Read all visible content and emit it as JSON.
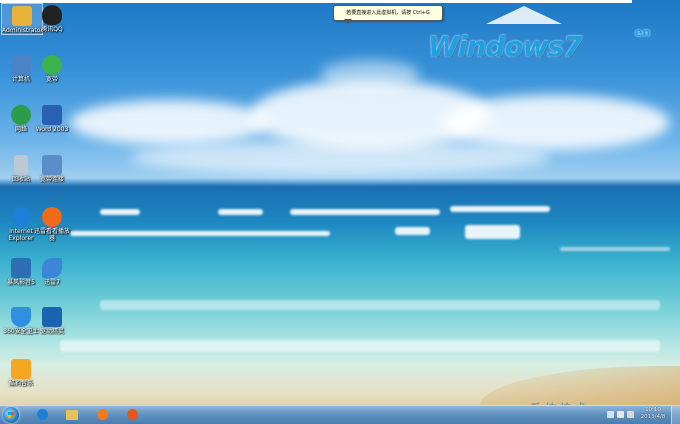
{
  "tooltip": {
    "text": "若要直接进入此虚拟机，请按 Ctrl+G"
  },
  "brand": {
    "main": "Windows7",
    "suffix": "en"
  },
  "desktop_icons": [
    {
      "label": "Administrator",
      "icon": "user-folder-icon",
      "color": "#e8b33a"
    },
    {
      "label": "腾讯QQ",
      "icon": "qq-penguin-icon",
      "color": "#222222"
    },
    {
      "label": "计算机",
      "icon": "computer-icon",
      "color": "#4a84c4"
    },
    {
      "label": "宽带",
      "icon": "network-icon",
      "color": "#3bb34a"
    },
    {
      "label": "网络",
      "icon": "globe-network-icon",
      "color": "#2d9c4a"
    },
    {
      "label": "Word 2003",
      "icon": "word-icon",
      "color": "#2b5fb2"
    },
    {
      "label": "回收站",
      "icon": "recycle-bin-icon",
      "color": "#bcc8d4"
    },
    {
      "label": "宽带连接",
      "icon": "broadband-connection-icon",
      "color": "#5b8dc9"
    },
    {
      "label": "Internet Explorer",
      "icon": "internet-explorer-icon",
      "color": "#1e7fd6"
    },
    {
      "label": "迅雷看看播放器",
      "icon": "xunlei-player-icon",
      "color": "#f06a1a"
    },
    {
      "label": "暴风影音5",
      "icon": "baofeng-player-icon",
      "color": "#2d6fb2"
    },
    {
      "label": "迅雷7",
      "icon": "xunlei-bird-icon",
      "color": "#3b86d6"
    },
    {
      "label": "360安全卫士",
      "icon": "shield-icon",
      "color": "#2f8fe0"
    },
    {
      "label": "驱动精灵",
      "icon": "driver-wizard-icon",
      "color": "#1a63b0"
    },
    {
      "label": "酷狗音乐",
      "icon": "kugou-icon",
      "color": "#f5a623"
    }
  ],
  "taskbar": {
    "pinned": [
      {
        "name": "internet-explorer",
        "color": "#1e7fd6"
      },
      {
        "name": "windows-explorer",
        "color": "#e8c15a"
      },
      {
        "name": "media-player",
        "color": "#f07b1a"
      },
      {
        "name": "xunlei-player",
        "color": "#e8561a"
      }
    ],
    "clock_time": "10:10",
    "clock_date": "2013/4/8"
  },
  "watermark": "系统技术"
}
